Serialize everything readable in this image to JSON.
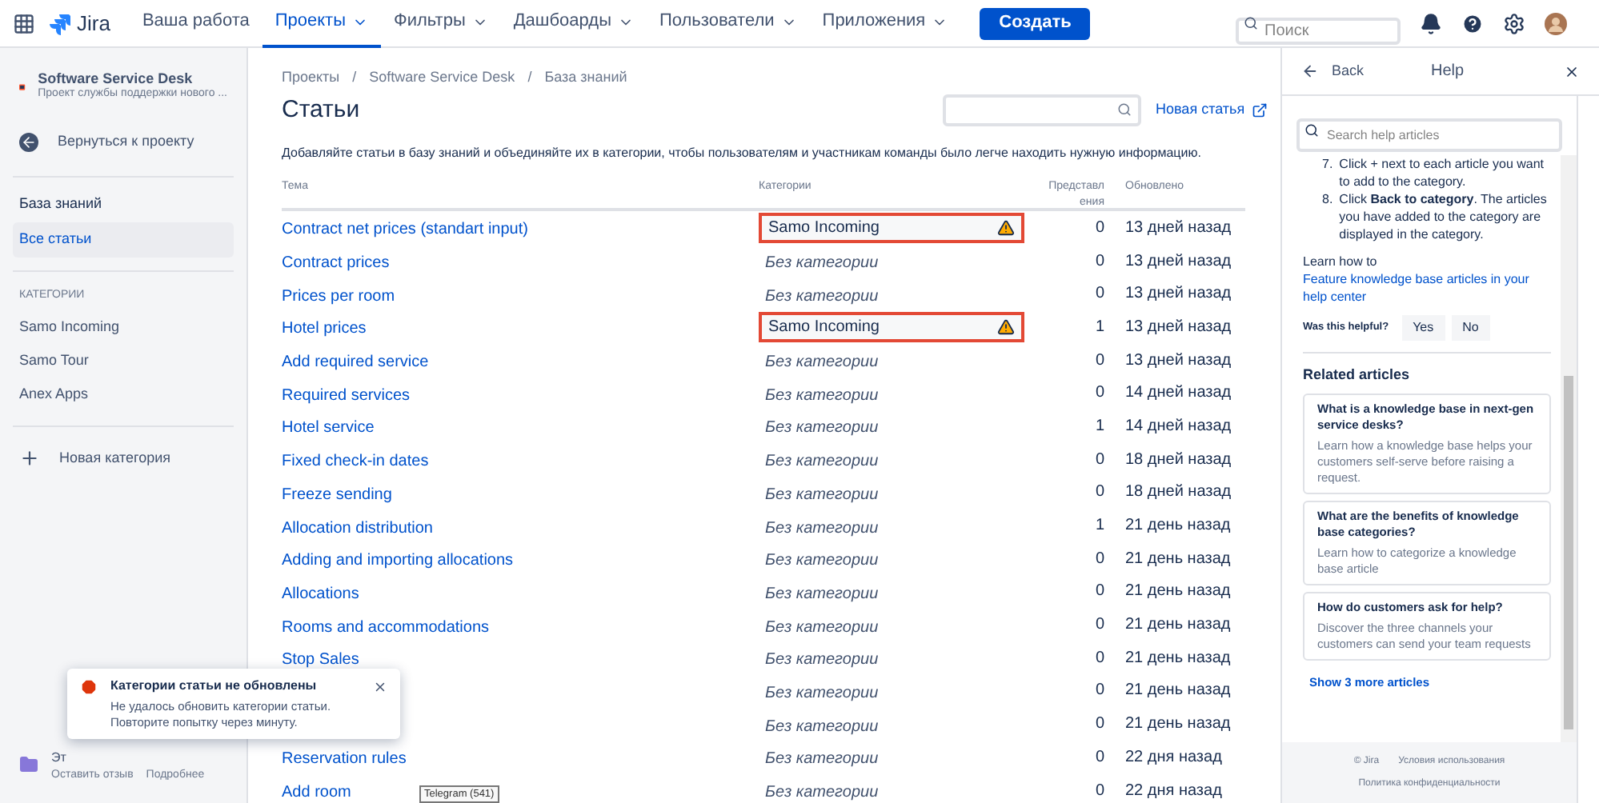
{
  "topbar": {
    "logo": "Jira",
    "nav": [
      {
        "label": "Ваша работа",
        "selected": false,
        "dropdown": false
      },
      {
        "label": "Проекты",
        "selected": true,
        "dropdown": true
      },
      {
        "label": "Фильтры",
        "selected": false,
        "dropdown": true
      },
      {
        "label": "Дашбоарды",
        "selected": false,
        "dropdown": true
      },
      {
        "label": "Пользователи",
        "selected": false,
        "dropdown": true
      },
      {
        "label": "Приложения",
        "selected": false,
        "dropdown": true
      }
    ],
    "create_button": "Создать",
    "search": {
      "placeholder": "Поиск"
    }
  },
  "sidebar": {
    "project": {
      "name": "Software Service Desk",
      "subtitle": "Проект службы поддержки нового ..."
    },
    "back": "Вернуться к проекту",
    "section": "База знаний",
    "items": [
      {
        "label": "Все статьи",
        "selected": true
      }
    ],
    "categories_heading": "КАТЕГОРИИ",
    "categories": [
      {
        "label": "Samo Incoming",
        "selected": false
      },
      {
        "label": "Samo Tour",
        "selected": false
      },
      {
        "label": "Anex Apps",
        "selected": false
      }
    ],
    "new_category": "Новая категория",
    "feedback": {
      "title": "Эт",
      "links": [
        "Оставить отзыв",
        "Подробнее"
      ]
    }
  },
  "breadcrumbs": [
    "Проекты",
    "Software Service Desk",
    "База знаний"
  ],
  "breadcrumb_separator": "/",
  "page_title": "Статьи",
  "new_article": "Новая статья",
  "description": "Добавляйте статьи в базу знаний и объединяйте их в категории, чтобы пользователям и участникам команды было легче находить нужную информацию.",
  "table": {
    "columns": [
      "Тема",
      "Категории",
      "Представл ения",
      "Обновлено"
    ],
    "rows": [
      {
        "title": "Contract net prices (standart input)",
        "category": "Samo Incoming",
        "kind": "assigned",
        "warning": true,
        "views": "0",
        "updated": "13 дней назад"
      },
      {
        "title": "Contract prices",
        "category": "Без категории",
        "kind": "none",
        "views": "0",
        "updated": "13 дней назад"
      },
      {
        "title": "Prices per room",
        "category": "Без категории",
        "kind": "none",
        "views": "0",
        "updated": "13 дней назад"
      },
      {
        "title": "Hotel prices",
        "category": "Samo Incoming",
        "kind": "assigned",
        "warning": true,
        "views": "1",
        "updated": "13 дней назад"
      },
      {
        "title": "Add required service",
        "category": "Без категории",
        "kind": "none",
        "views": "0",
        "updated": "13 дней назад"
      },
      {
        "title": "Required services",
        "category": "Без категории",
        "kind": "none",
        "views": "0",
        "updated": "14 дней назад"
      },
      {
        "title": "Hotel service",
        "category": "Без категории",
        "kind": "none",
        "views": "1",
        "updated": "14 дней назад"
      },
      {
        "title": "Fixed check-in dates",
        "category": "Без категории",
        "kind": "none",
        "views": "0",
        "updated": "18 дней назад"
      },
      {
        "title": "Freeze sending",
        "category": "Без категории",
        "kind": "none",
        "views": "0",
        "updated": "18 дней назад"
      },
      {
        "title": "Allocation distribution",
        "category": "Без категории",
        "kind": "none",
        "views": "1",
        "updated": "21 день назад"
      },
      {
        "title": "Adding and importing allocations",
        "category": "Без категории",
        "kind": "none",
        "views": "0",
        "updated": "21 день назад"
      },
      {
        "title": "Allocations",
        "category": "Без категории",
        "kind": "none",
        "views": "0",
        "updated": "21 день назад"
      },
      {
        "title": "Rooms and accommodations",
        "category": "Без категории",
        "kind": "none",
        "views": "0",
        "updated": "21 день назад"
      },
      {
        "title": "Stop Sales",
        "category": "Без категории",
        "kind": "none",
        "views": "0",
        "updated": "21 день назад"
      },
      {
        "category": "Без категории",
        "kind": "none",
        "views": "0",
        "updated": "21 день назад"
      },
      {
        "category": "Без категории",
        "kind": "none",
        "views": "0",
        "updated": "21 день назад"
      },
      {
        "title": "Reservation rules",
        "category": "Без категории",
        "kind": "none",
        "views": "0",
        "updated": "22 дня назад"
      },
      {
        "title": "Add room",
        "category": "Без категории",
        "kind": "none",
        "views": "0",
        "updated": "22 дня назад"
      }
    ]
  },
  "toast": {
    "title": "Категории статьи не обновлены",
    "message": "Не удалось обновить категории статьи. Повторите попытку через минуту."
  },
  "tooltip": "Telegram (541)",
  "help": {
    "back": "Back",
    "title": "Help",
    "search": {
      "placeholder": "Search help articles"
    },
    "steps": [
      {
        "number": "7.",
        "text": "Click + next to each article you want to add to the category."
      },
      {
        "number": "8.",
        "text": "Click **Back to category**. The articles you have added to the category are displayed in the category."
      }
    ],
    "learn_prefix": "Learn how to",
    "learn_link": "Feature knowledge base articles in your help center",
    "helpful": {
      "question": "Was this helpful?",
      "buttons": [
        "Yes",
        "No"
      ]
    },
    "related_heading": "Related articles",
    "related": [
      {
        "title": "What is a knowledge base in next-gen service desks?",
        "summary": "Learn how a knowledge base helps your customers self-serve before raising a request."
      },
      {
        "title": "What are the benefits of knowledge base categories?",
        "summary": "Learn how to categorize a knowledge base article"
      },
      {
        "title": "How do customers ask for help?",
        "summary": "Discover the three channels your customers can send your team requests"
      }
    ],
    "show_more": "Show 3 more articles",
    "footer": [
      "© Jira",
      "Условия использования",
      "Политика конфиденциальности"
    ]
  }
}
